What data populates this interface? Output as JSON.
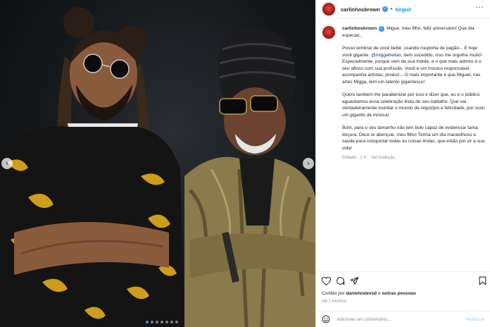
{
  "post": {
    "username": "carlinhosbrown",
    "follow_label": "Seguir",
    "separator": "•",
    "more_label": "···"
  },
  "caption": {
    "username": "carlinhosbrown",
    "intro": "Migue, meu filho, feliz aniversário! Que dia especial...",
    "p1_before": "Posso lembrar de você bebê, usando roupinha de pagão... E hoje você gigante.",
    "p1_mention": "@miggafreitas",
    "p1_after": ", bem sucedido, isso me orgulha muito! Especialmente, porque vem da sua índole, e o que mais admiro é o seu afinco com sua profissão. Você é um músico responsável, acompanha artistas, produz... O mais importante é que Miguel, nas artes Migga, tem um talento gigantesco!",
    "p2": "Quero também lhe parabenizar por isso e dizer que, eu e o público aguardamos essa celebração linda do seu trabalho. Que vai verdadeiramente inundar o mundo de regozijos e felicidade, por ouvir um gigante da música!",
    "p3": "Bom, para o seu tamanho não tem bolo capaz de evidenciar tanta doçura. Deus te abençoe, meu filho! Tenha um dia maravilhoso e saúde para conquistar todas as coisas lindas, que estão por vir a sua vida!",
    "edited": "Editado · 2 h",
    "translate": "Ver tradução"
  },
  "engagement": {
    "liked_prefix": "Curtido por",
    "liked_user": "danielestevsd",
    "liked_and": "e",
    "liked_others": "outras pessoas",
    "time_ago": "HÁ 2 HORAS"
  },
  "comment_box": {
    "placeholder": "Adicione um comentário...",
    "publish_label": "Publicar"
  },
  "carousel": {
    "prev_label": "‹",
    "next_label": "›",
    "dot_count": 7,
    "active_index": 0
  },
  "colors": {
    "accent": "#0095f6",
    "mention": "#00376b",
    "muted": "#8e8e8e",
    "border": "#efefef"
  },
  "icons": [
    "heart-icon",
    "comment-icon",
    "share-icon",
    "bookmark-icon",
    "emoji-icon",
    "verified-badge-icon",
    "more-icon"
  ]
}
